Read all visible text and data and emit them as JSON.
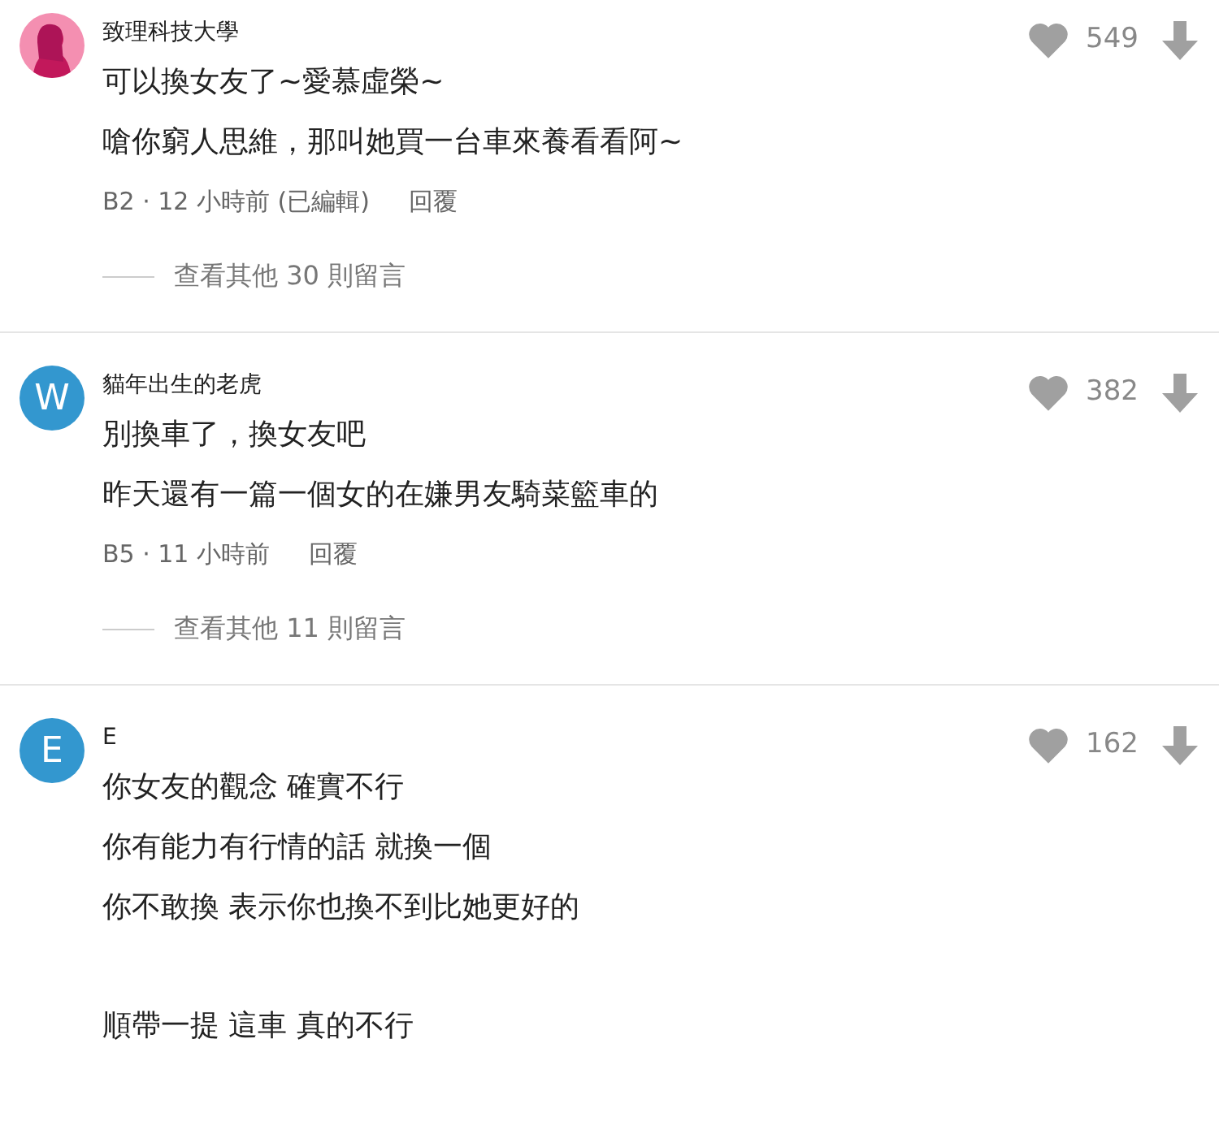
{
  "comments": [
    {
      "author": "致理科技大學",
      "avatar": {
        "kind": "picture",
        "color": "#f48fb1"
      },
      "likes": "549",
      "paragraphs": [
        [
          "可以換女友了~愛慕虛榮~",
          "嗆你窮人思維，那叫她買一台車來養看看阿~"
        ]
      ],
      "meta": "B2 · 12 小時前 (已編輯)",
      "reply": "回覆",
      "more": "查看其他 30 則留言"
    },
    {
      "author": "貓年出生的老虎",
      "avatar": {
        "kind": "letter",
        "letter": "W",
        "color": "#3397cf"
      },
      "likes": "382",
      "paragraphs": [
        [
          "別換車了，換女友吧",
          "昨天還有一篇一個女的在嫌男友騎菜籃車的"
        ]
      ],
      "meta": "B5 · 11 小時前",
      "reply": "回覆",
      "more": "查看其他 11 則留言"
    },
    {
      "author": "E",
      "avatar": {
        "kind": "letter",
        "letter": "E",
        "color": "#3397cf"
      },
      "likes": "162",
      "paragraphs": [
        [
          "你女友的觀念 確實不行",
          "你有能力有行情的話 就換一個",
          "你不敢換 表示你也換不到比她更好的"
        ],
        [
          "順帶一提 這車 真的不行"
        ]
      ]
    }
  ]
}
